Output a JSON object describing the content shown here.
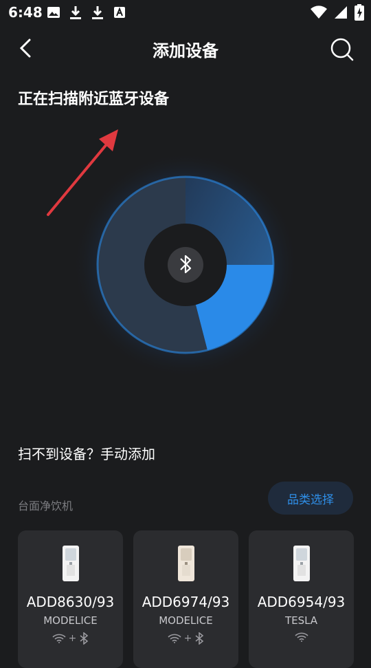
{
  "status_bar": {
    "time": "6:48"
  },
  "header": {
    "title": "添加设备"
  },
  "scan": {
    "title": "正在扫描附近蓝牙设备"
  },
  "manual_add": "扫不到设备？手动添加",
  "category": {
    "label": "台面净饮机",
    "select_button": "品类选择"
  },
  "devices": [
    {
      "model": "ADD8630/93",
      "brand": "MODELICE",
      "connectivity": [
        "wifi",
        "bluetooth"
      ],
      "body_color": "#ffffff"
    },
    {
      "model": "ADD6974/93",
      "brand": "MODELICE",
      "connectivity": [
        "wifi",
        "bluetooth"
      ],
      "body_color": "#efe6da"
    },
    {
      "model": "ADD6954/93",
      "brand": "TESLA",
      "connectivity": [
        "wifi"
      ],
      "body_color": "#ffffff"
    }
  ],
  "colors": {
    "accent": "#2f8fe8",
    "arrow": "#e0393f",
    "background": "#1b1c1e"
  }
}
